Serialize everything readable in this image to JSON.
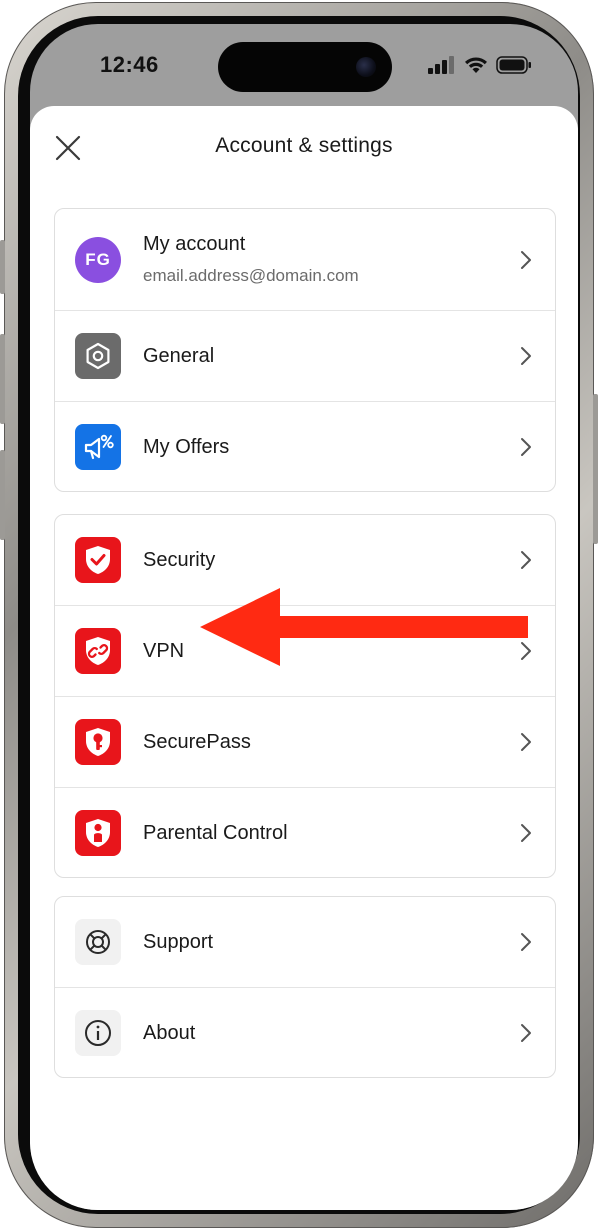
{
  "status_bar": {
    "time": "12:46"
  },
  "header": {
    "title": "Account & settings",
    "close_icon": "close-icon"
  },
  "groups": [
    {
      "rows": [
        {
          "label": "My account",
          "sublabel": "email.address@domain.com",
          "avatar_initials": "FG",
          "avatar_color": "#8a4fe0"
        }
      ]
    }
  ],
  "account": {
    "label": "My account",
    "email": "email.address@domain.com",
    "initials": "FG"
  },
  "general": {
    "label": "General",
    "icon": "hexagon-settings-icon",
    "icon_color": "#6b6b6b"
  },
  "offers": {
    "label": "My Offers",
    "icon": "megaphone-percent-icon",
    "icon_color": "#1473e6"
  },
  "security": {
    "label": "Security",
    "icon": "shield-check-icon",
    "icon_color": "#e8151b"
  },
  "vpn": {
    "label": "VPN",
    "icon": "shield-link-icon",
    "icon_color": "#e8151b"
  },
  "securepass": {
    "label": "SecurePass",
    "icon": "shield-key-icon",
    "icon_color": "#e8151b"
  },
  "parental": {
    "label": "Parental Control",
    "icon": "shield-person-icon",
    "icon_color": "#e8151b"
  },
  "support": {
    "label": "Support",
    "icon": "lifebuoy-icon"
  },
  "about": {
    "label": "About",
    "icon": "info-icon"
  },
  "annotation": {
    "type": "red-arrow",
    "points_to": "VPN",
    "color": "#ff2a12"
  }
}
